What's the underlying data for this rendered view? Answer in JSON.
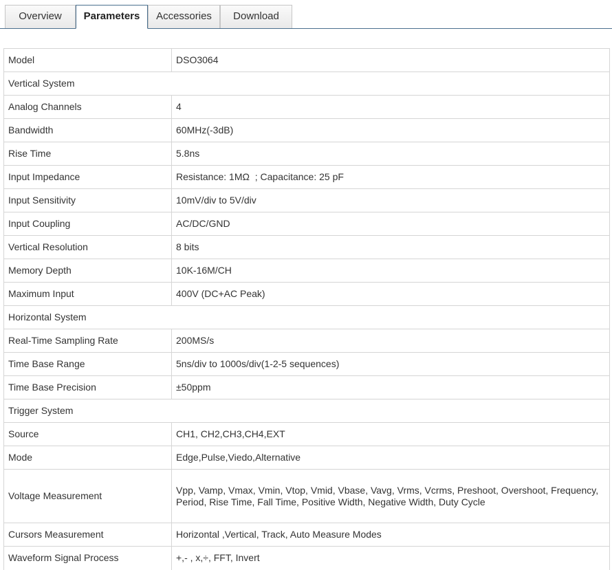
{
  "tabs": [
    {
      "label": "Overview"
    },
    {
      "label": "Parameters"
    },
    {
      "label": "Accessories"
    },
    {
      "label": "Download"
    }
  ],
  "specs": {
    "model": {
      "label": "Model",
      "value": "DSO3064"
    },
    "vertical_system": {
      "label": "Vertical System"
    },
    "analog_channels": {
      "label": "Analog Channels",
      "value": "4"
    },
    "bandwidth": {
      "label": "Bandwidth",
      "value": "60MHz(-3dB)"
    },
    "rise_time": {
      "label": "Rise Time",
      "value": "5.8ns"
    },
    "input_impedance": {
      "label": "Input Impedance",
      "value": "Resistance: 1MΩ  ; Capacitance: 25 pF"
    },
    "input_sensitivity": {
      "label": "Input Sensitivity",
      "value": "10mV/div to 5V/div"
    },
    "input_coupling": {
      "label": "Input Coupling",
      "value": "AC/DC/GND"
    },
    "vertical_resolution": {
      "label": "Vertical Resolution",
      "value": "8 bits"
    },
    "memory_depth": {
      "label": "Memory Depth",
      "value": "10K-16M/CH"
    },
    "maximum_input": {
      "label": "Maximum Input",
      "value": "400V (DC+AC Peak)"
    },
    "horizontal_system": {
      "label": "Horizontal System"
    },
    "sampling_rate": {
      "label": "Real-Time Sampling Rate",
      "value": "200MS/s"
    },
    "time_base_range": {
      "label": "Time Base Range",
      "value": "5ns/div to 1000s/div(1-2-5 sequences)"
    },
    "time_base_precision": {
      "label": "Time Base Precision",
      "value": "±50ppm"
    },
    "trigger_system": {
      "label": "Trigger System"
    },
    "source": {
      "label": "Source",
      "value": "CH1, CH2,CH3,CH4,EXT"
    },
    "mode": {
      "label": "Mode",
      "value": "Edge,Pulse,Viedo,Alternative"
    },
    "voltage_measurement": {
      "label": "Voltage Measurement",
      "value": "Vpp, Vamp, Vmax, Vmin, Vtop, Vmid, Vbase, Vavg, Vrms, Vcrms, Preshoot, Overshoot, Frequency, Period, Rise Time, Fall Time, Positive Width, Negative Width, Duty Cycle"
    },
    "cursors_measurement": {
      "label": "Cursors Measurement",
      "value": "Horizontal ,Vertical, Track, Auto Measure Modes"
    },
    "waveform_signal_process": {
      "label": "Waveform Signal Process",
      "value": "+,- , x,÷, FFT, Invert"
    }
  }
}
